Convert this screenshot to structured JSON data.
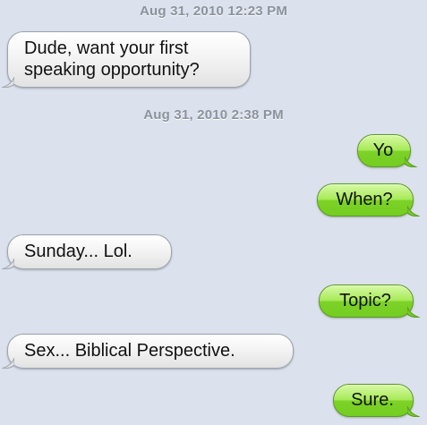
{
  "thread": {
    "timestamps": [
      "Aug 31, 2010 12:23 PM",
      "Aug 31, 2010 2:38 PM"
    ],
    "messages": [
      {
        "direction": "received",
        "text": "Dude, want your first speaking opportunity?"
      },
      {
        "direction": "sent",
        "text": "Yo"
      },
      {
        "direction": "sent",
        "text": "When?"
      },
      {
        "direction": "received",
        "text": "Sunday... Lol."
      },
      {
        "direction": "sent",
        "text": "Topic?"
      },
      {
        "direction": "received",
        "text": "Sex... Biblical Perspective."
      },
      {
        "direction": "sent",
        "text": "Sure."
      }
    ]
  },
  "colors": {
    "background": "#dbe2ed",
    "sent_bubble": "#7dd227",
    "received_bubble": "#f4f4f4",
    "timestamp_text": "#8c929c"
  }
}
